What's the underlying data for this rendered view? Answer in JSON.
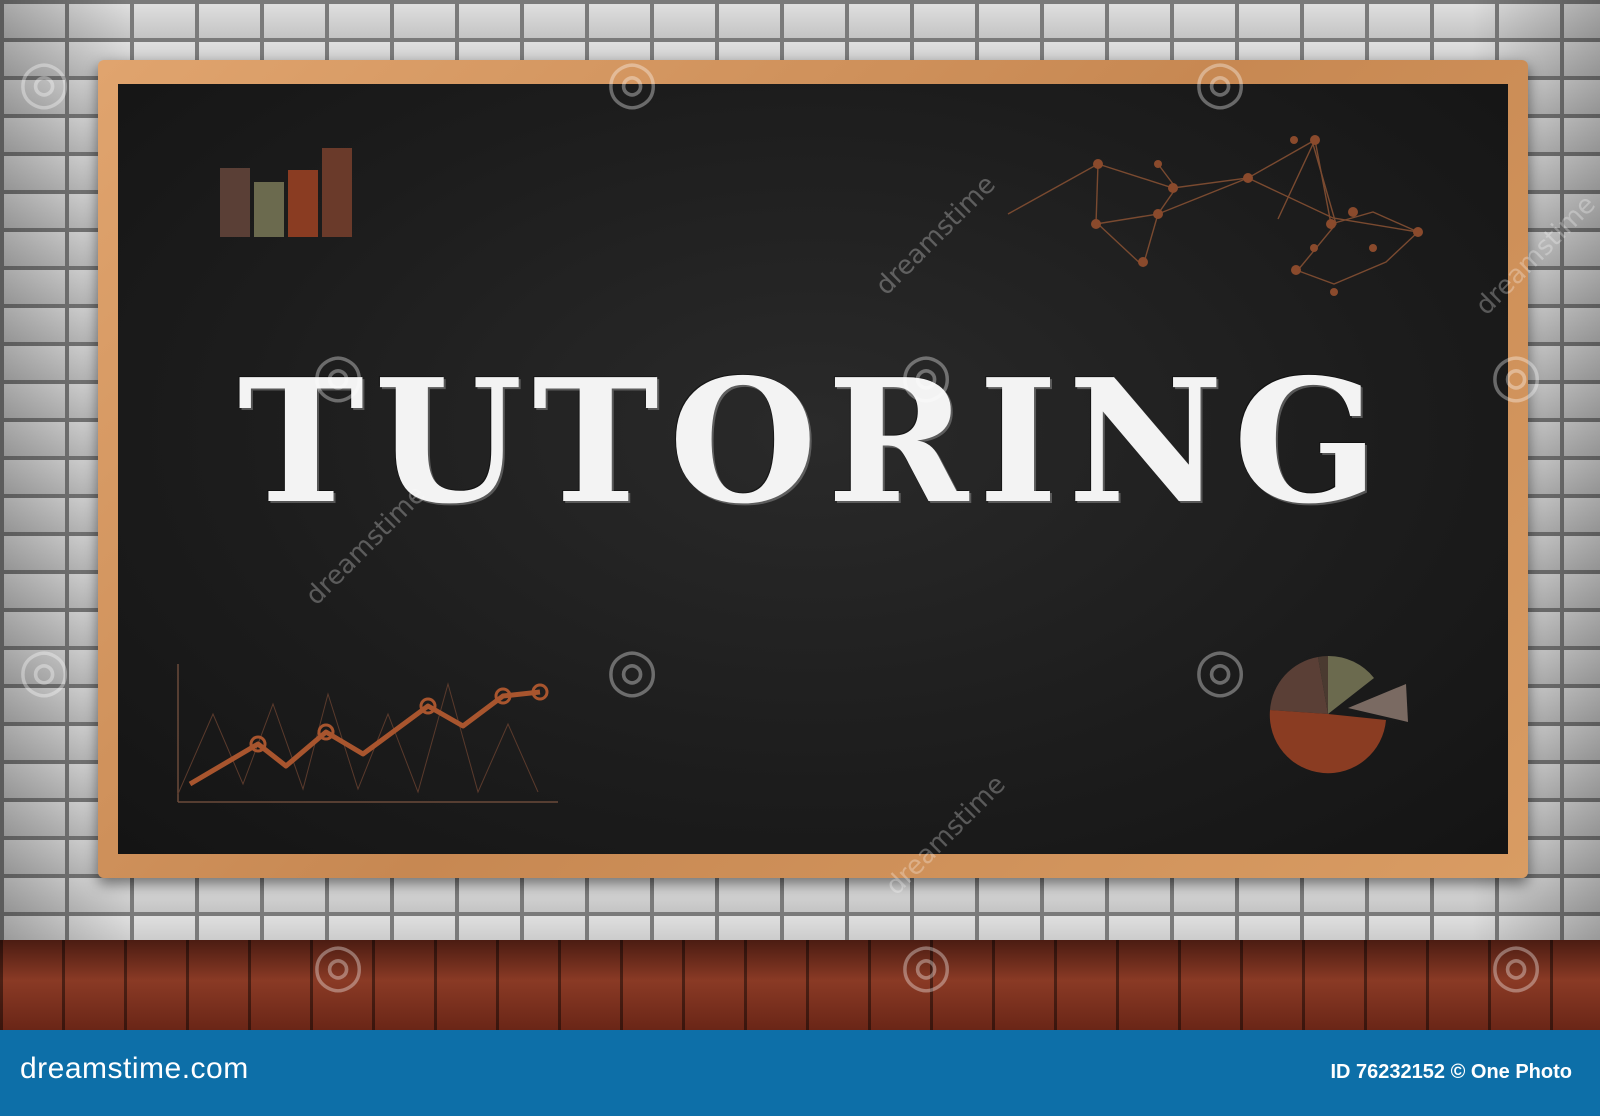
{
  "board": {
    "headline": "TUTORING"
  },
  "watermark": {
    "text": "dreamstime"
  },
  "footer": {
    "site": "dreamstime.com",
    "credit": "ID 76232152 © One Photo"
  },
  "colors": {
    "chalk": "#f3f3f3",
    "footer_bg": "#0d6fa8",
    "accent_orange": "#a8552e",
    "accent_olive": "#6e6e4e"
  }
}
